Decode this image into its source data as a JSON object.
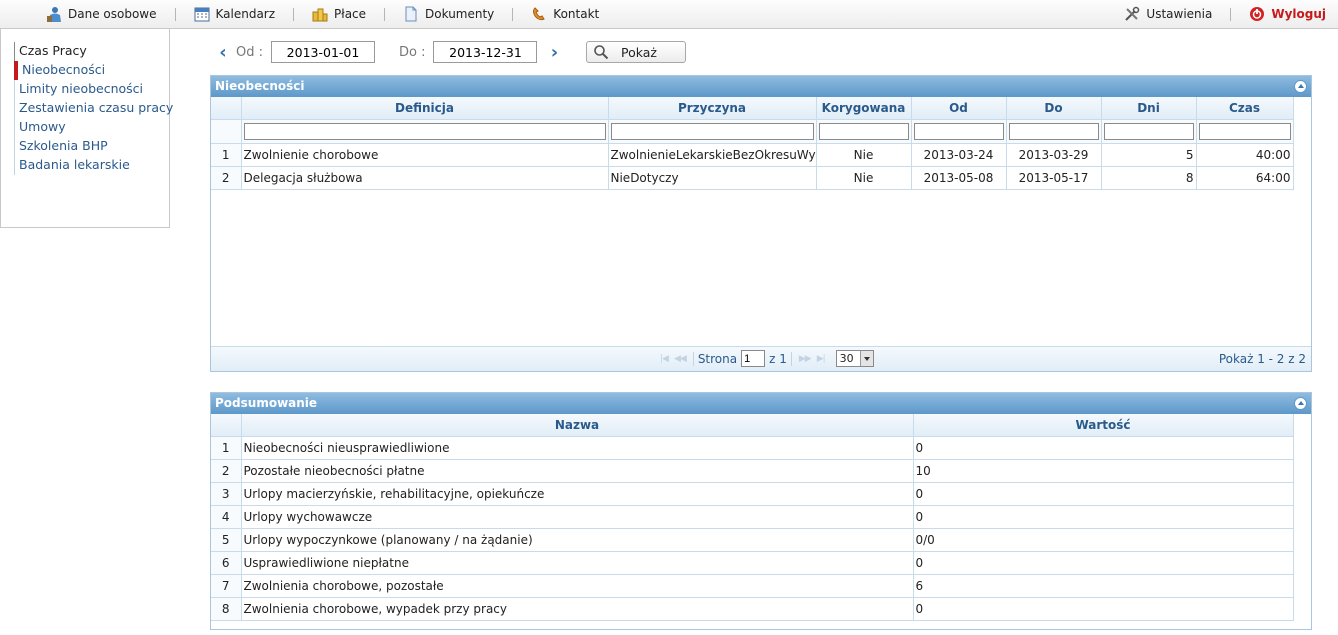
{
  "topnav": {
    "items": [
      {
        "label": "Dane osobowe",
        "icon": "person-icon"
      },
      {
        "label": "Kalendarz",
        "icon": "calendar-icon"
      },
      {
        "label": "Płace",
        "icon": "coins-icon"
      },
      {
        "label": "Dokumenty",
        "icon": "document-icon"
      },
      {
        "label": "Kontakt",
        "icon": "phone-icon"
      }
    ],
    "settings_label": "Ustawienia",
    "logout_label": "Wyloguj"
  },
  "sidebar": {
    "items": [
      {
        "label": "Czas Pracy"
      },
      {
        "label": "Nieobecności"
      },
      {
        "label": "Limity nieobecności"
      },
      {
        "label": "Zestawienia czasu pracy"
      },
      {
        "label": "Umowy"
      },
      {
        "label": "Szkolenia BHP"
      },
      {
        "label": "Badania lekarskie"
      }
    ],
    "active_index": 1
  },
  "filter": {
    "from_label": "Od :",
    "from_value": "2013-01-01",
    "to_label": "Do :",
    "to_value": "2013-12-31",
    "show_button": "Pokaż"
  },
  "absences": {
    "title": "Nieobecności",
    "columns": [
      "Definicja",
      "Przyczyna",
      "Korygowana",
      "Od",
      "Do",
      "Dni",
      "Czas"
    ],
    "rows": [
      {
        "n": "1",
        "definicja": "Zwolnienie chorobowe",
        "przyczyna": "ZwolnienieLekarskieBezOkresuWycz",
        "korygowana": "Nie",
        "od": "2013-03-24",
        "do": "2013-03-29",
        "dni": "5",
        "czas": "40:00"
      },
      {
        "n": "2",
        "definicja": "Delegacja służbowa",
        "przyczyna": "NieDotyczy",
        "korygowana": "Nie",
        "od": "2013-05-08",
        "do": "2013-05-17",
        "dni": "8",
        "czas": "64:00"
      }
    ],
    "pager": {
      "page_label": "Strona",
      "page_value": "1",
      "of_label": "z 1",
      "page_size": "30",
      "info": "Pokaż 1 - 2 z 2"
    }
  },
  "summary": {
    "title": "Podsumowanie",
    "columns": [
      "Nazwa",
      "Wartość"
    ],
    "rows": [
      {
        "n": "1",
        "name": "Nieobecności nieusprawiedliwione",
        "value": "0"
      },
      {
        "n": "2",
        "name": "Pozostałe nieobecności płatne",
        "value": "10"
      },
      {
        "n": "3",
        "name": "Urlopy macierzyńskie, rehabilitacyjne, opiekuńcze",
        "value": "0"
      },
      {
        "n": "4",
        "name": "Urlopy wychowawcze",
        "value": "0"
      },
      {
        "n": "5",
        "name": "Urlopy wypoczynkowe (planowany / na żądanie)",
        "value": "0/0"
      },
      {
        "n": "6",
        "name": "Usprawiedliwione niepłatne",
        "value": "0"
      },
      {
        "n": "7",
        "name": "Zwolnienia chorobowe, pozostałe",
        "value": "6"
      },
      {
        "n": "8",
        "name": "Zwolnienia chorobowe, wypadek przy pracy",
        "value": "0"
      }
    ]
  },
  "colors": {
    "accent": "#5d98c9",
    "link": "#2a5a8c",
    "logout": "#c61a1a"
  }
}
